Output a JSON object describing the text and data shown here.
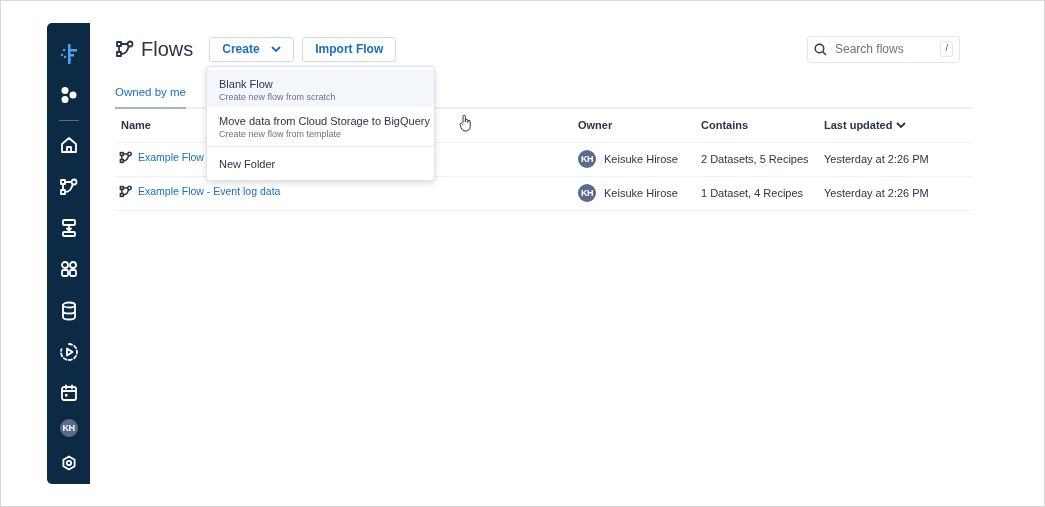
{
  "sidebar": {
    "avatar_initials": "KH"
  },
  "header": {
    "title": "Flows",
    "create_button": "Create",
    "import_button": "Import Flow",
    "search": {
      "placeholder": "Search flows",
      "shortcut": "/"
    }
  },
  "tabs": [
    {
      "label": "Owned by me",
      "selected": true
    }
  ],
  "table": {
    "columns": [
      {
        "label": "Name",
        "sorted": false
      },
      {
        "label": "Owner",
        "sorted": false
      },
      {
        "label": "Contains",
        "sorted": false
      },
      {
        "label": "Last updated",
        "sorted": true
      }
    ],
    "rows": [
      {
        "name": "Example Flow",
        "owner_initials": "KH",
        "owner": "Keisuke Hirose",
        "contains": "2 Datasets, 5 Recipes",
        "updated": "Yesterday at 2:26 PM"
      },
      {
        "name": "Example Flow - Event log data",
        "owner_initials": "KH",
        "owner": "Keisuke Hirose",
        "contains": "1 Dataset, 4 Recipes",
        "updated": "Yesterday at 2:26 PM"
      }
    ]
  },
  "create_menu": {
    "items": [
      {
        "label": "Blank Flow",
        "description": "Create new flow from scratch",
        "hovered": true
      },
      {
        "label": "Move data from Cloud Storage to BigQuery",
        "description": "Create new flow from template",
        "hovered": false
      },
      {
        "label": "New Folder",
        "hovered": false
      }
    ]
  }
}
